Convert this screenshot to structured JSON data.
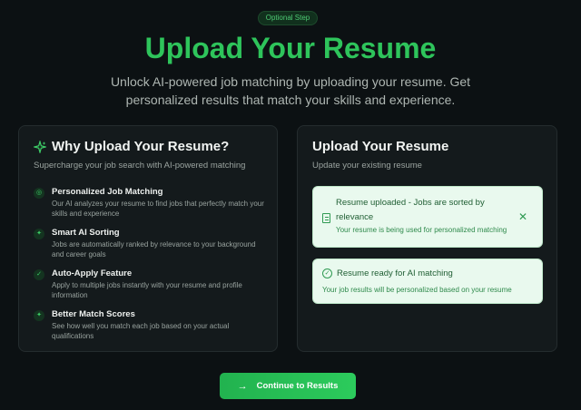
{
  "badge": "Optional Step",
  "title": "Upload Your Resume",
  "subtitle": "Unlock AI-powered job matching by uploading your resume. Get personalized results that match your skills and experience.",
  "why": {
    "title": "Why Upload Your Resume?",
    "subtitle": "Supercharge your job search with AI-powered matching",
    "features": [
      {
        "title": "Personalized Job Matching",
        "desc": "Our AI analyzes your resume to find jobs that perfectly match your skills and experience",
        "icon": "target-icon"
      },
      {
        "title": "Smart AI Sorting",
        "desc": "Jobs are automatically ranked by relevance to your background and career goals",
        "icon": "sparkle-icon"
      },
      {
        "title": "Auto-Apply Feature",
        "desc": "Apply to multiple jobs instantly with your resume and profile information",
        "icon": "check-icon"
      },
      {
        "title": "Better Match Scores",
        "desc": "See how well you match each job based on your actual qualifications",
        "icon": "sparkle-icon"
      }
    ]
  },
  "upload": {
    "title": "Upload Your Resume",
    "subtitle": "Update your existing resume",
    "notice1": {
      "title": "Resume uploaded - Jobs are sorted by relevance",
      "desc": "Your resume is being used for personalized matching",
      "close": "✕"
    },
    "notice2": {
      "title": "Resume ready for AI matching",
      "desc": "Your job results will be personalized based on your resume"
    }
  },
  "cta": {
    "label": "Continue to Results",
    "arrow": "→"
  },
  "colors": {
    "accent": "#2ec45b",
    "background": "#0c1113",
    "card": "#141a1c",
    "notice_bg": "#e9f9ee"
  }
}
